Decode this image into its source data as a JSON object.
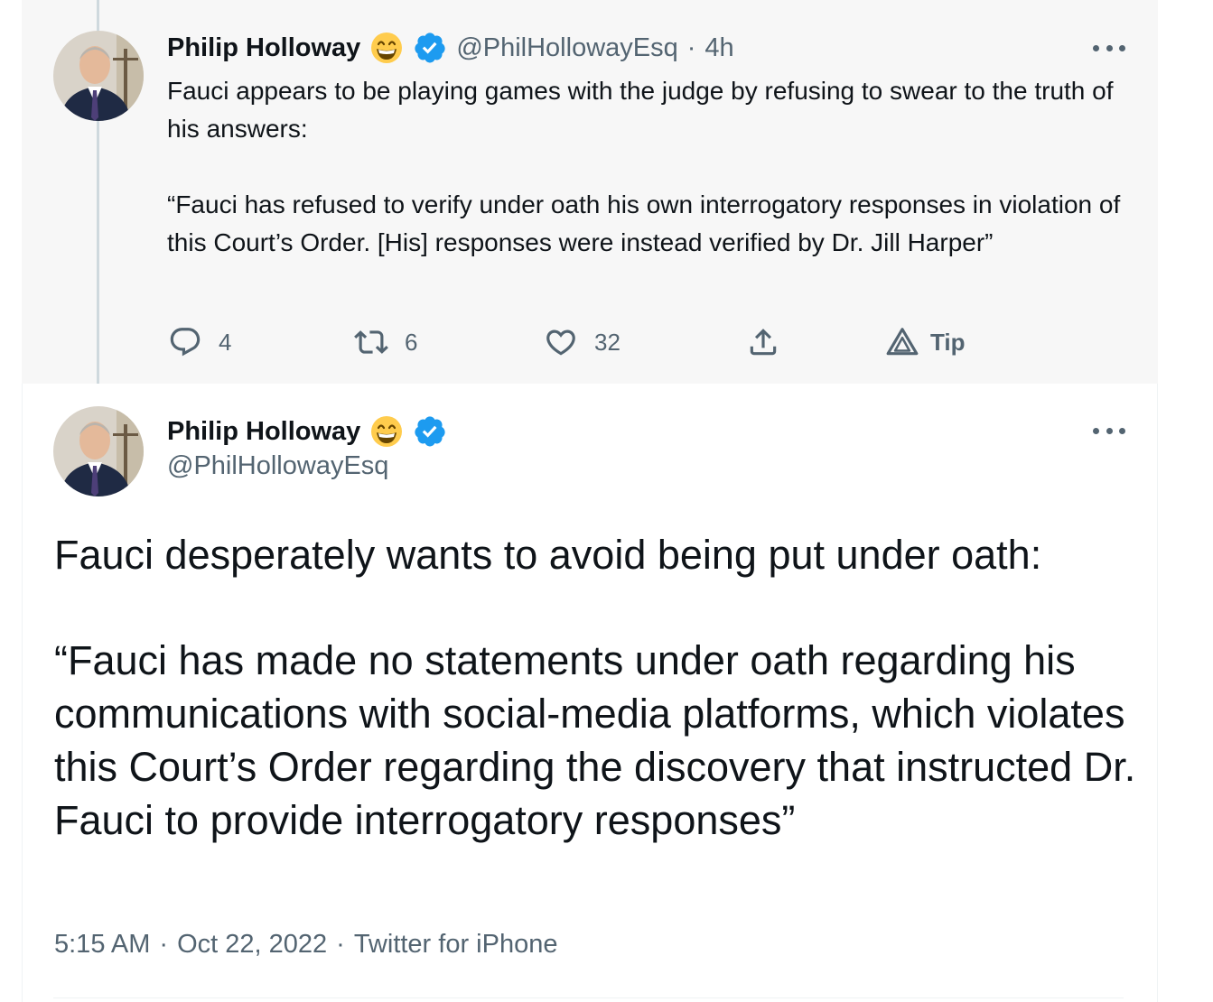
{
  "tweets": {
    "reply": {
      "author_name": "Philip Holloway",
      "handle": "@PhilHollowayEsq",
      "separator": "·",
      "time": "4h",
      "paragraphs": [
        "Fauci appears to be playing games with the judge by refusing to swear to the truth of his answers:",
        "“Fauci has refused to verify under oath his own interrogatory responses in violation of this Court’s Order. [His] responses were instead verified by Dr. Jill Harper”"
      ],
      "actions": {
        "reply_count": "4",
        "retweet_count": "6",
        "like_count": "32",
        "tip_label": "Tip"
      }
    },
    "main": {
      "author_name": "Philip Holloway",
      "handle": "@PhilHollowayEsq",
      "paragraphs": [
        "Fauci desperately wants to avoid being put under oath:",
        "“Fauci has made no statements under oath regarding his communications with social-media platforms, which violates this Court’s Order regarding the discovery that instructed Dr. Fauci to provide interrogatory responses”"
      ],
      "time": "5:15 AM",
      "date": "Oct 22, 2022",
      "source": "Twitter for iPhone",
      "separator": "·"
    }
  },
  "icons": {
    "verified": "verified-badge-icon",
    "emoji": "grinning-face-emoji",
    "reply": "reply-icon",
    "retweet": "retweet-icon",
    "like": "heart-icon",
    "share": "share-icon",
    "tip": "tip-icon",
    "more": "more-icon"
  },
  "colors": {
    "verified_blue": "#1d9bf0",
    "secondary_text": "#536471",
    "primary_text": "#0f1419",
    "thread_line": "#cfd9de",
    "highlight_bg": "#f7f7f7"
  }
}
